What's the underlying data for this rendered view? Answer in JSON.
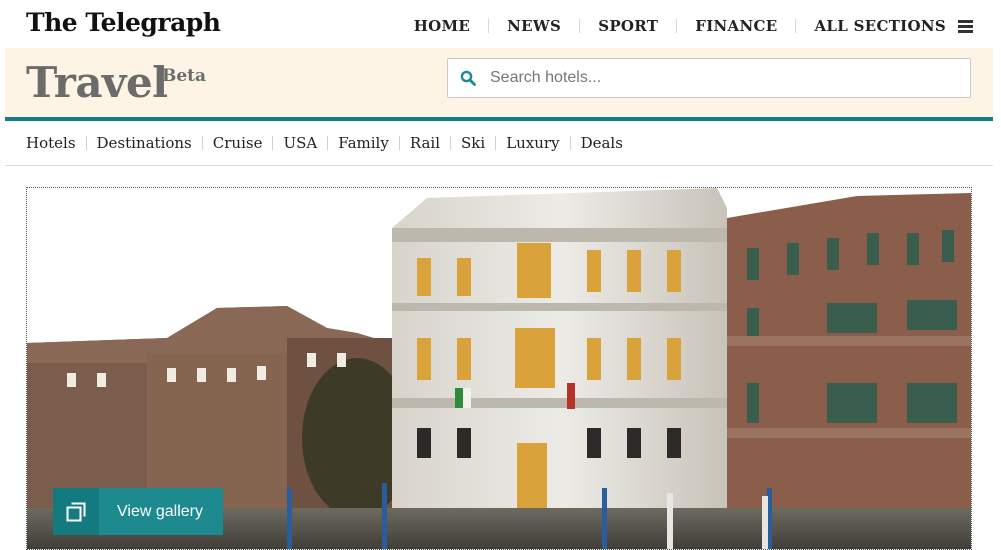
{
  "brand": {
    "logo_text": "The Telegraph"
  },
  "main_nav": [
    {
      "label": "HOME"
    },
    {
      "label": "NEWS"
    },
    {
      "label": "SPORT"
    },
    {
      "label": "FINANCE"
    },
    {
      "label": "ALL SECTIONS",
      "icon": "hamburger-menu-icon"
    }
  ],
  "section": {
    "title": "Travel",
    "badge": "Beta"
  },
  "search": {
    "placeholder": "Search hotels...",
    "value": "",
    "icon": "search-icon"
  },
  "sub_nav": [
    {
      "label": "Hotels"
    },
    {
      "label": "Destinations"
    },
    {
      "label": "Cruise"
    },
    {
      "label": "USA"
    },
    {
      "label": "Family"
    },
    {
      "label": "Rail"
    },
    {
      "label": "Ski"
    },
    {
      "label": "Luxury"
    },
    {
      "label": "Deals"
    }
  ],
  "hero": {
    "gallery_button": {
      "label": "View gallery",
      "icon": "gallery-icon"
    }
  },
  "colors": {
    "accent_teal": "#137d83",
    "header_bg": "#fdf4e6",
    "gallery_btn": "#1d8a8f"
  }
}
